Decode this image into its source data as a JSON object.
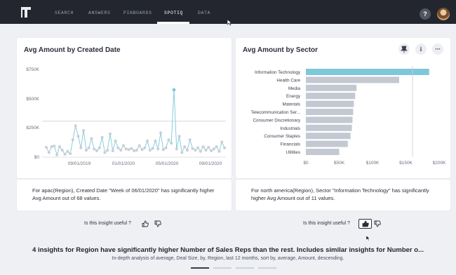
{
  "nav": {
    "items": [
      "SEARCH",
      "ANSWERS",
      "PINBOARDS",
      "SPOTIQ",
      "DATA"
    ],
    "active_index": 3,
    "help_label": "?"
  },
  "left_card": {
    "title": "Avg Amount by Created Date",
    "insight": "For apac(Region), Created Date \"Week of 06/01/2020\" has significantly higher Avg Amount out of 68 values.",
    "feedback_label": "Is this insight useful ?"
  },
  "right_card": {
    "title": "Avg Amount by Sector",
    "insight": "For north america(Region), Sector \"Information Technology\" has significantly higher Avg Amount out of 11 values.",
    "feedback_label": "Is this insight useful ?",
    "actions": [
      "pin-icon",
      "info-icon",
      "more-icon"
    ]
  },
  "summary": {
    "headline": "4 insights for Region have significantly higher Number of Sales Reps than the rest. Includes similar insights for Number o...",
    "subline": "In-depth analysis of average, Deal Size, by, Region, last 12 months, sort by, average, Amount, descending.",
    "pages": 4,
    "active_page": 0
  },
  "colors": {
    "nav_bg": "#23262f",
    "highlight": "#7ec8dc",
    "bar": "#c3c8d2",
    "point": "#c9ced6",
    "line": "#7ec8dc"
  },
  "chart_data": [
    {
      "type": "line",
      "title": "Avg Amount by Created Date",
      "x_tick_labels": [
        "09/01/2019",
        "01/01/2020",
        "05/01/2020",
        "09/01/2020"
      ],
      "y_tick_labels": [
        "$750K",
        "$500K",
        "$250K",
        "$0"
      ],
      "ylim": [
        0,
        750000
      ],
      "reference_line": 310000,
      "highlight_point": {
        "x": "Week of 06/01/2020",
        "y": 580000
      },
      "series": [
        {
          "values": [
            85000,
            40000,
            90000,
            95000,
            20000,
            90000,
            60000,
            25000,
            50000,
            30000,
            150000,
            270000,
            180000,
            80000,
            230000,
            60000,
            80000,
            160000,
            70000,
            55000,
            80000,
            170000,
            40000,
            60000,
            200000,
            55000,
            140000,
            80000,
            60000,
            100000,
            70000,
            65000,
            75000,
            55000,
            60000,
            100000,
            65000,
            80000,
            140000,
            60000,
            75000,
            140000,
            70000,
            210000,
            65000,
            80000,
            150000,
            120000,
            580000,
            70000,
            180000,
            40000,
            90000,
            60000,
            150000,
            75000,
            60000,
            80000,
            50000,
            90000,
            60000,
            85000,
            55000,
            70000,
            90000,
            50000,
            130000,
            80000
          ]
        }
      ]
    },
    {
      "type": "bar",
      "orientation": "horizontal",
      "title": "Avg Amount by Sector",
      "categories": [
        "Information Technology",
        "Health Care",
        "Media",
        "Energy",
        "Materials",
        "Telecommunication Ser...",
        "Consumer Discretionary",
        "Industrials",
        "Consumer Staples",
        "Financials",
        "Utilities"
      ],
      "values": [
        185000,
        140000,
        76000,
        74000,
        72000,
        71000,
        70000,
        69000,
        67000,
        63000,
        50000
      ],
      "highlight_index": 0,
      "x_tick_labels": [
        "$0",
        "$50K",
        "$100K",
        "$150K",
        "$200K"
      ],
      "xlim": [
        0,
        200000
      ],
      "reference_line": 160000
    }
  ]
}
